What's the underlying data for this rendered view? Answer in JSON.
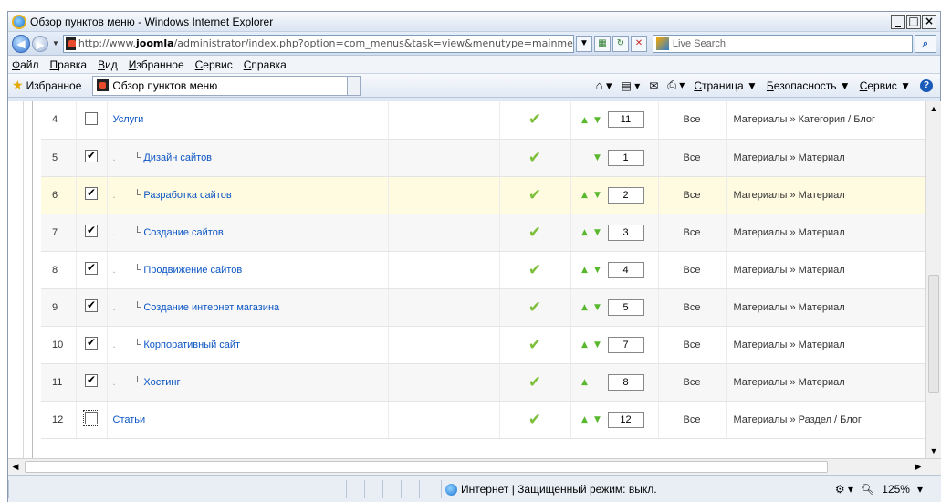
{
  "window": {
    "title": "Обзор пунктов меню - Windows Internet Explorer"
  },
  "address": {
    "prefix": "http://www.",
    "host": "joomla",
    "path": "/administrator/index.php?option=com_menus&task=view&menutype=mainme",
    "search_placeholder": "Live Search"
  },
  "menubar": [
    "Файл",
    "Правка",
    "Вид",
    "Избранное",
    "Сервис",
    "Справка"
  ],
  "favbar": {
    "favorites_label": "Избранное",
    "tab_title": "Обзор пунктов меню",
    "commands": {
      "page": "Страница ▼",
      "safety": "Безопасность ▼",
      "service": "Сервис ▼"
    }
  },
  "rows": [
    {
      "num": "4",
      "checked": false,
      "level": 0,
      "name": "Услуги",
      "order": "11",
      "access": "Все",
      "type": "Материалы » Категория / Блог",
      "up": true,
      "down": true
    },
    {
      "num": "5",
      "checked": true,
      "level": 1,
      "name": "Дизайн сайтов",
      "order": "1",
      "access": "Все",
      "type": "Материалы » Материал",
      "up": false,
      "down": true
    },
    {
      "num": "6",
      "checked": true,
      "level": 1,
      "name": "Разработка сайтов",
      "order": "2",
      "access": "Все",
      "type": "Материалы » Материал",
      "up": true,
      "down": true,
      "highlight": true
    },
    {
      "num": "7",
      "checked": true,
      "level": 1,
      "name": "Создание сайтов",
      "order": "3",
      "access": "Все",
      "type": "Материалы » Материал",
      "up": true,
      "down": true
    },
    {
      "num": "8",
      "checked": true,
      "level": 1,
      "name": "Продвижение сайтов",
      "order": "4",
      "access": "Все",
      "type": "Материалы » Материал",
      "up": true,
      "down": true
    },
    {
      "num": "9",
      "checked": true,
      "level": 1,
      "name": "Создание интернет магазина",
      "order": "5",
      "access": "Все",
      "type": "Материалы » Материал",
      "up": true,
      "down": true
    },
    {
      "num": "10",
      "checked": true,
      "level": 1,
      "name": "Корпоративный сайт",
      "order": "7",
      "access": "Все",
      "type": "Материалы » Материал",
      "up": true,
      "down": true
    },
    {
      "num": "11",
      "checked": true,
      "level": 1,
      "name": "Хостинг",
      "order": "8",
      "access": "Все",
      "type": "Материалы » Материал",
      "up": true,
      "down": false
    },
    {
      "num": "12",
      "checked": false,
      "level": 0,
      "name": "Статьи",
      "order": "12",
      "access": "Все",
      "type": "Материалы » Раздел / Блог",
      "up": true,
      "down": true,
      "focus": true
    }
  ],
  "status": {
    "zone": "Интернет | Защищенный режим: выкл.",
    "zoom": "125%"
  },
  "colors": {
    "link": "#0b55c4",
    "access": "#198f00",
    "tick": "#7cbf3a",
    "highlight_row": "#fffbe0"
  },
  "icons": {
    "published": "check-icon",
    "order_up": "up-arrow-icon",
    "order_down": "down-arrow-icon"
  }
}
